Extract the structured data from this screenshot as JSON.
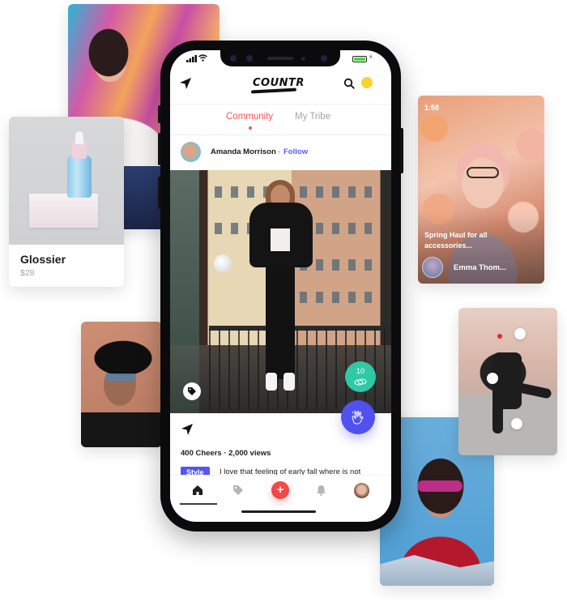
{
  "phone": {
    "status_bar": {
      "signal_icon": "signal-bars-icon",
      "wifi_icon": "wifi-icon",
      "battery_icon": "battery-charging-icon",
      "signal_text": "▂▄▆ ◠"
    },
    "header": {
      "logo_text": "COUNTR",
      "left_icon": "send-icon",
      "right_icons": [
        "search-icon",
        "coin-icon"
      ]
    },
    "tabs": [
      {
        "label": "Community",
        "active": true
      },
      {
        "label": "My Tribe",
        "active": false
      }
    ],
    "post": {
      "author": "Amanda Morrison",
      "separator": "·",
      "follow_label": "Follow",
      "coin_count": "10",
      "stats": "400 Cheers · 2,000 views",
      "tag": "Style",
      "caption": "I love that feeling of early fall where is not"
    },
    "bottom_nav": [
      {
        "icon": "home-icon",
        "active": true
      },
      {
        "icon": "tag-icon",
        "active": false
      },
      {
        "icon": "plus-icon",
        "label": "+",
        "active": false
      },
      {
        "icon": "bell-icon",
        "active": false
      },
      {
        "icon": "profile-avatar",
        "active": false
      }
    ],
    "colors": {
      "accent_red": "#f45454",
      "accent_blue": "#5555f2",
      "coin_green": "#2fc9a6",
      "coin_yellow": "#fad233"
    }
  },
  "product_card": {
    "name": "Glossier",
    "price": "$28"
  },
  "story_card": {
    "time": "1:58",
    "title": "Spring  Haul for all accessories...",
    "author": "Emma Thom..."
  }
}
